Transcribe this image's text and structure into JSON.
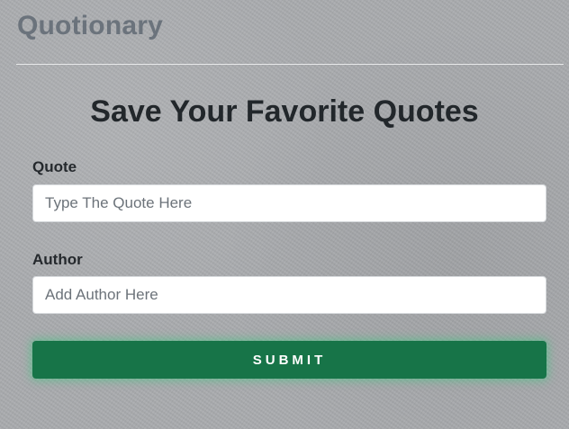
{
  "navbar": {
    "brand": "Quotionary"
  },
  "main": {
    "title": "Save Your Favorite Quotes"
  },
  "form": {
    "quote_label": "Quote",
    "quote_placeholder": "Type The Quote Here",
    "quote_value": "",
    "author_label": "Author",
    "author_placeholder": "Add Author Here",
    "author_value": "",
    "submit_label": "SUBMIT"
  },
  "colors": {
    "brand_text": "#6b737c",
    "submit_bg": "#177448",
    "submit_glow": "#36c87d",
    "background": "#a9abae"
  }
}
